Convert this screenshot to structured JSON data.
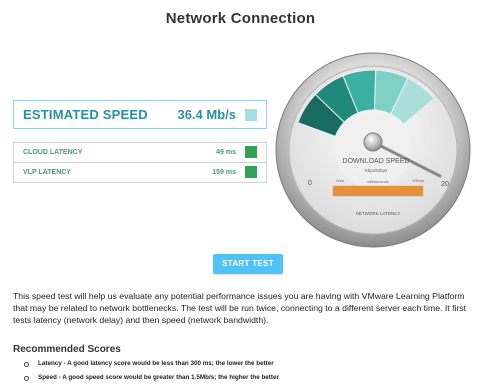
{
  "title": "Network Connection",
  "estimated": {
    "label": "ESTIMATED SPEED",
    "value": "36.4 Mb/s",
    "swatch_color": "#a8dde4"
  },
  "latency": {
    "rows": [
      {
        "label": "CLOUD LATENCY",
        "value": "49 ms",
        "swatch_color": "#31a354"
      },
      {
        "label": "VLP LATENCY",
        "value": "159 ms",
        "swatch_color": "#31a354"
      }
    ]
  },
  "gauge": {
    "title": "DOWNLOAD SPEED",
    "units": "Kbps/Mbps",
    "scale_min": "0",
    "scale_max": "20",
    "latency_min": "0ms",
    "latency_mid": "milliseconds",
    "latency_max": "100ms",
    "latency_caption": "NETWORK LATENCY",
    "latency_fraction": 1.0,
    "segment_colors": [
      "#186b61",
      "#20897c",
      "#39b0a2",
      "#7fd1c6",
      "#a9dfd8"
    ]
  },
  "start_button": "START TEST",
  "description": "This speed test will help us evaluate any potential performance issues you are having with VMware Learning Platform that may be related to network bottlenecks. The test will be run twice, connecting to a different server each time. It first tests latency (network delay) and then speed (network bandwidth).",
  "recommended": {
    "title": "Recommended Scores",
    "items": [
      "Latency - A good latency score would be less than 300 ms; the lower the better",
      "Speed - A good speed score would be greater than 1.5Mb/s; the higher the better"
    ]
  }
}
